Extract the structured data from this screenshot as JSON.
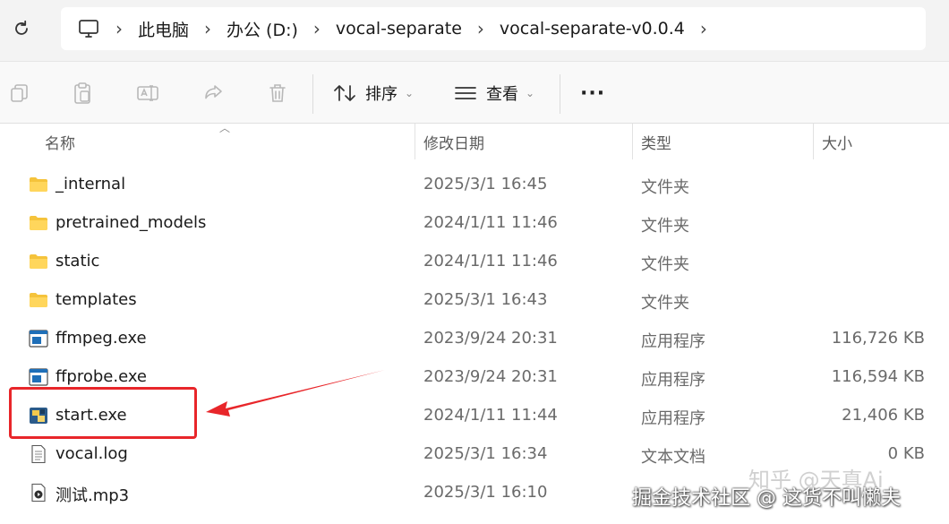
{
  "address_bar": {
    "crumbs": [
      "此电脑",
      "办公 (D:)",
      "vocal-separate",
      "vocal-separate-v0.0.4"
    ],
    "separator": "›"
  },
  "toolbar": {
    "sort_label": "排序",
    "view_label": "查看",
    "more_label": "···"
  },
  "columns": {
    "name": "名称",
    "modified": "修改日期",
    "type": "类型",
    "size": "大小"
  },
  "files": [
    {
      "name": "_internal",
      "modified": "2025/3/1 16:45",
      "type": "文件夹",
      "size": "",
      "icon": "folder-icon"
    },
    {
      "name": "pretrained_models",
      "modified": "2024/1/11 11:46",
      "type": "文件夹",
      "size": "",
      "icon": "folder-icon"
    },
    {
      "name": "static",
      "modified": "2024/1/11 11:46",
      "type": "文件夹",
      "size": "",
      "icon": "folder-icon"
    },
    {
      "name": "templates",
      "modified": "2025/3/1 16:43",
      "type": "文件夹",
      "size": "",
      "icon": "folder-icon"
    },
    {
      "name": "ffmpeg.exe",
      "modified": "2023/9/24 20:31",
      "type": "应用程序",
      "size": "116,726 KB",
      "icon": "exe-icon"
    },
    {
      "name": "ffprobe.exe",
      "modified": "2023/9/24 20:31",
      "type": "应用程序",
      "size": "116,594 KB",
      "icon": "exe-icon"
    },
    {
      "name": "start.exe",
      "modified": "2024/1/11 11:44",
      "type": "应用程序",
      "size": "21,406 KB",
      "icon": "python-exe-icon"
    },
    {
      "name": "vocal.log",
      "modified": "2025/3/1 16:34",
      "type": "文本文档",
      "size": "0 KB",
      "icon": "text-file-icon"
    },
    {
      "name": "测试.mp3",
      "modified": "2025/3/1 16:10",
      "type": "",
      "size": "",
      "icon": "audio-file-icon"
    }
  ],
  "watermark": {
    "line1": "知乎 @天真Ai",
    "line2": "掘金技术社区 @ 这货不叫懒夫"
  },
  "colors": {
    "highlight": "#e8262a",
    "folder": "#f5c33b",
    "exe_blue": "#1f6fb8"
  }
}
